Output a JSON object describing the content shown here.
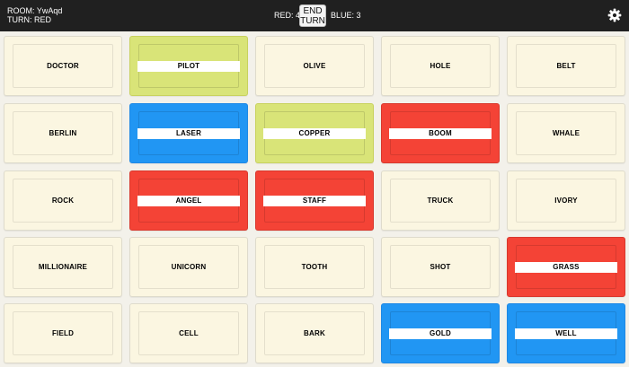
{
  "header": {
    "room_label": "ROOM: YwAqd",
    "turn_label": "TURN: RED",
    "red_score": "RED: 4",
    "end_turn_line1": "END",
    "end_turn_line2": "TURN",
    "blue_score": "BLUE: 3",
    "settings_icon": "gear-icon"
  },
  "colors": {
    "red": "#f44336",
    "blue": "#2196f3",
    "yellow": "#d9e478",
    "neutral": "#fbf6e1",
    "topbar": "#202020"
  },
  "cards": [
    {
      "word": "DOCTOR",
      "state": "neutral"
    },
    {
      "word": "PILOT",
      "state": "yellow"
    },
    {
      "word": "OLIVE",
      "state": "neutral"
    },
    {
      "word": "HOLE",
      "state": "neutral"
    },
    {
      "word": "BELT",
      "state": "neutral"
    },
    {
      "word": "BERLIN",
      "state": "neutral"
    },
    {
      "word": "LASER",
      "state": "blue"
    },
    {
      "word": "COPPER",
      "state": "yellow"
    },
    {
      "word": "BOOM",
      "state": "red"
    },
    {
      "word": "WHALE",
      "state": "neutral"
    },
    {
      "word": "ROCK",
      "state": "neutral"
    },
    {
      "word": "ANGEL",
      "state": "red"
    },
    {
      "word": "STAFF",
      "state": "red"
    },
    {
      "word": "TRUCK",
      "state": "neutral"
    },
    {
      "word": "IVORY",
      "state": "neutral"
    },
    {
      "word": "MILLIONAIRE",
      "state": "neutral"
    },
    {
      "word": "UNICORN",
      "state": "neutral"
    },
    {
      "word": "TOOTH",
      "state": "neutral"
    },
    {
      "word": "SHOT",
      "state": "neutral"
    },
    {
      "word": "GRASS",
      "state": "red"
    },
    {
      "word": "FIELD",
      "state": "neutral"
    },
    {
      "word": "CELL",
      "state": "neutral"
    },
    {
      "word": "BARK",
      "state": "neutral"
    },
    {
      "word": "GOLD",
      "state": "blue"
    },
    {
      "word": "WELL",
      "state": "blue"
    }
  ]
}
